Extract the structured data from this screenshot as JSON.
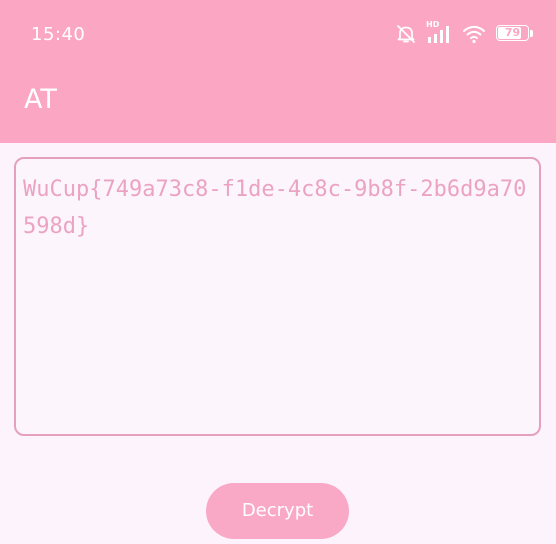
{
  "status_bar": {
    "time": "15:40",
    "network_badge": "HD",
    "battery_level": "79",
    "battery_fraction": 0.79,
    "icons": [
      "bell-muted-icon",
      "signal-icon",
      "wifi-icon",
      "battery-icon"
    ]
  },
  "app_bar": {
    "title": "AT"
  },
  "main": {
    "text_value": "WuCup{749a73c8-f1de-4c8c-9b8f-2b6d9a70598d}",
    "decrypt_label": "Decrypt"
  },
  "colors": {
    "primary": "#fba7c3",
    "background": "#fcf3fc",
    "field_border": "#e6a0bf",
    "field_text": "#eba3c4",
    "button": "#f9a9c5"
  }
}
